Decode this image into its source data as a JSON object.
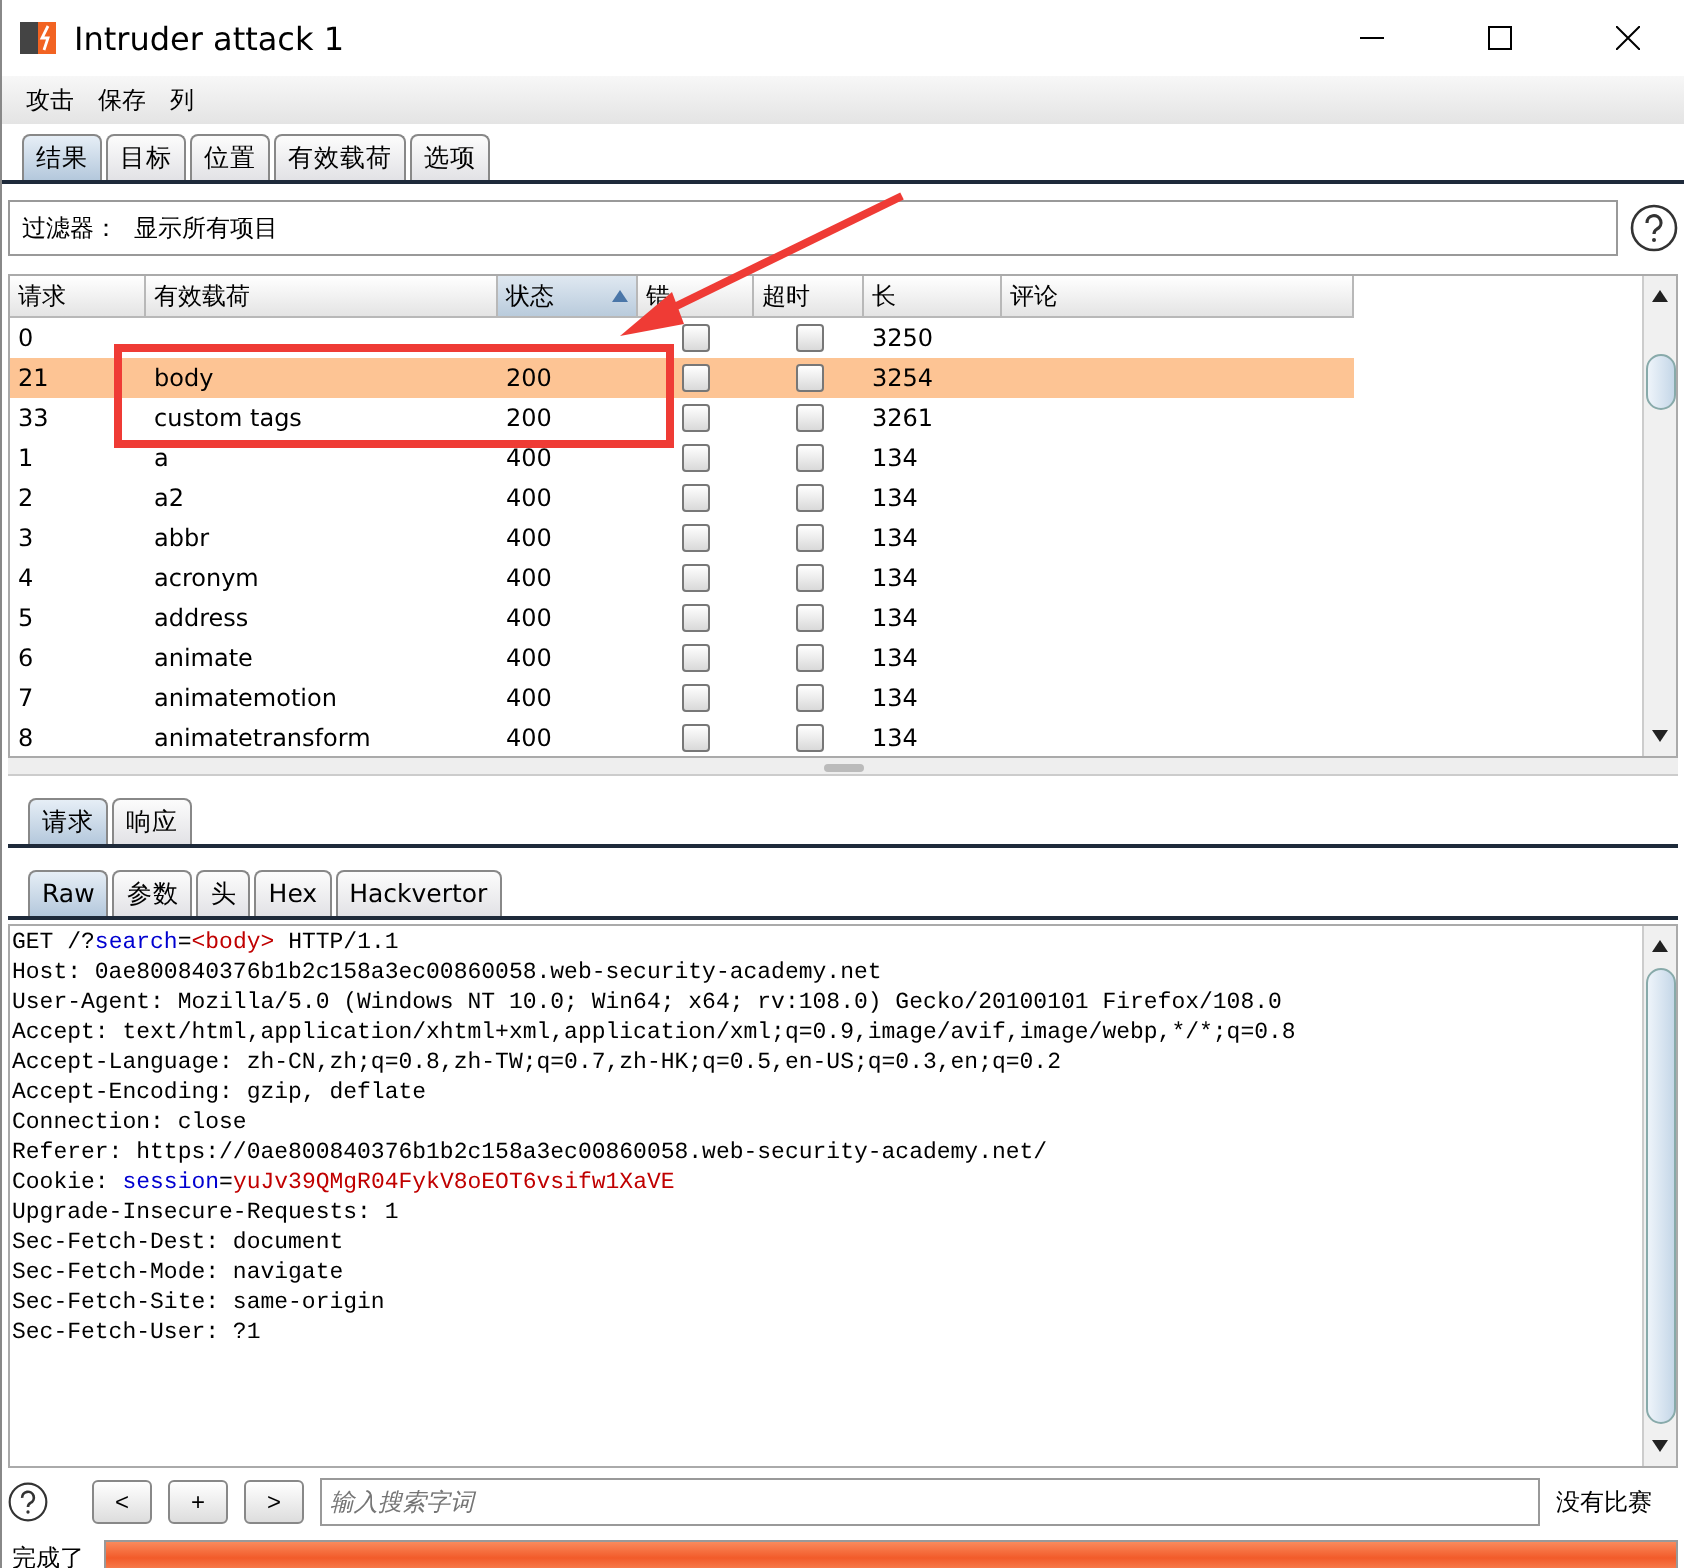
{
  "window": {
    "title": "Intruder attack 1"
  },
  "menu": [
    "攻击",
    "保存",
    "列"
  ],
  "tabs": [
    {
      "label": "结果",
      "selected": true
    },
    {
      "label": "目标",
      "selected": false
    },
    {
      "label": "位置",
      "selected": false
    },
    {
      "label": "有效载荷",
      "selected": false
    },
    {
      "label": "选项",
      "selected": false
    }
  ],
  "filter": {
    "label": "过滤器：",
    "value": "显示所有项目"
  },
  "table": {
    "columns": [
      {
        "label": "请求",
        "sorted": false
      },
      {
        "label": "有效载荷",
        "sorted": false
      },
      {
        "label": "状态",
        "sorted": true
      },
      {
        "label": "错",
        "sorted": false
      },
      {
        "label": "超时",
        "sorted": false
      },
      {
        "label": "长",
        "sorted": false
      },
      {
        "label": "评论",
        "sorted": false
      }
    ],
    "rows": [
      {
        "request": "0",
        "error": false,
        "timeout": false,
        "length": "3250",
        "selected": false
      },
      {
        "request": "21",
        "payload": "body",
        "status": "200",
        "error": false,
        "timeout": false,
        "length": "3254",
        "selected": true
      },
      {
        "request": "33",
        "payload": "custom tags",
        "status": "200",
        "error": false,
        "timeout": false,
        "length": "3261",
        "selected": false
      },
      {
        "request": "1",
        "payload": "a",
        "status": "400",
        "error": false,
        "timeout": false,
        "length": "134",
        "selected": false
      },
      {
        "request": "2",
        "payload": "a2",
        "status": "400",
        "error": false,
        "timeout": false,
        "length": "134",
        "selected": false
      },
      {
        "request": "3",
        "payload": "abbr",
        "status": "400",
        "error": false,
        "timeout": false,
        "length": "134",
        "selected": false
      },
      {
        "request": "4",
        "payload": "acronym",
        "status": "400",
        "error": false,
        "timeout": false,
        "length": "134",
        "selected": false
      },
      {
        "request": "5",
        "payload": "address",
        "status": "400",
        "error": false,
        "timeout": false,
        "length": "134",
        "selected": false
      },
      {
        "request": "6",
        "payload": "animate",
        "status": "400",
        "error": false,
        "timeout": false,
        "length": "134",
        "selected": false
      },
      {
        "request": "7",
        "payload": "animatemotion",
        "status": "400",
        "error": false,
        "timeout": false,
        "length": "134",
        "selected": false
      },
      {
        "request": "8",
        "payload": "animatetransform",
        "status": "400",
        "error": false,
        "timeout": false,
        "length": "134",
        "selected": false
      }
    ]
  },
  "message_tabs": [
    {
      "label": "请求",
      "selected": true
    },
    {
      "label": "响应",
      "selected": false
    }
  ],
  "view_tabs": [
    {
      "label": "Raw",
      "selected": true
    },
    {
      "label": "参数",
      "selected": false
    },
    {
      "label": "头",
      "selected": false
    },
    {
      "label": "Hex",
      "selected": false
    },
    {
      "label": "Hackvertor",
      "selected": false
    }
  ],
  "request_lines": [
    [
      {
        "text": "GET /?",
        "kind": "plain"
      },
      {
        "text": "search",
        "kind": "name"
      },
      {
        "text": "=",
        "kind": "plain"
      },
      {
        "text": "<body>",
        "kind": "value"
      },
      {
        "text": " HTTP/1.1",
        "kind": "plain"
      }
    ],
    [
      {
        "text": "Host: 0ae800840376b1b2c158a3ec00860058.web-security-academy.net",
        "kind": "plain"
      }
    ],
    [
      {
        "text": "User-Agent: Mozilla/5.0 (Windows NT 10.0; Win64; x64; rv:108.0) Gecko/20100101 Firefox/108.0",
        "kind": "plain"
      }
    ],
    [
      {
        "text": "Accept: text/html,application/xhtml+xml,application/xml;q=0.9,image/avif,image/webp,*/*;q=0.8",
        "kind": "plain"
      }
    ],
    [
      {
        "text": "Accept-Language: zh-CN,zh;q=0.8,zh-TW;q=0.7,zh-HK;q=0.5,en-US;q=0.3,en;q=0.2",
        "kind": "plain"
      }
    ],
    [
      {
        "text": "Accept-Encoding: gzip, deflate",
        "kind": "plain"
      }
    ],
    [
      {
        "text": "Connection: close",
        "kind": "plain"
      }
    ],
    [
      {
        "text": "Referer: https://0ae800840376b1b2c158a3ec00860058.web-security-academy.net/",
        "kind": "plain"
      }
    ],
    [
      {
        "text": "Cookie: ",
        "kind": "plain"
      },
      {
        "text": "session",
        "kind": "name"
      },
      {
        "text": "=",
        "kind": "plain"
      },
      {
        "text": "yuJv39QMgR04FykV8oEOT6vsifw1XaVE",
        "kind": "value"
      }
    ],
    [
      {
        "text": "Upgrade-Insecure-Requests: 1",
        "kind": "plain"
      }
    ],
    [
      {
        "text": "Sec-Fetch-Dest: document",
        "kind": "plain"
      }
    ],
    [
      {
        "text": "Sec-Fetch-Mode: navigate",
        "kind": "plain"
      }
    ],
    [
      {
        "text": "Sec-Fetch-Site: same-origin",
        "kind": "plain"
      }
    ],
    [
      {
        "text": "Sec-Fetch-User: ?1",
        "kind": "plain"
      }
    ]
  ],
  "search_bar": {
    "buttons": [
      "<",
      "+",
      ">"
    ],
    "placeholder": "输入搜索字词",
    "matches": "没有比赛"
  },
  "status_bar": {
    "text": "完成了",
    "level": 1
  }
}
